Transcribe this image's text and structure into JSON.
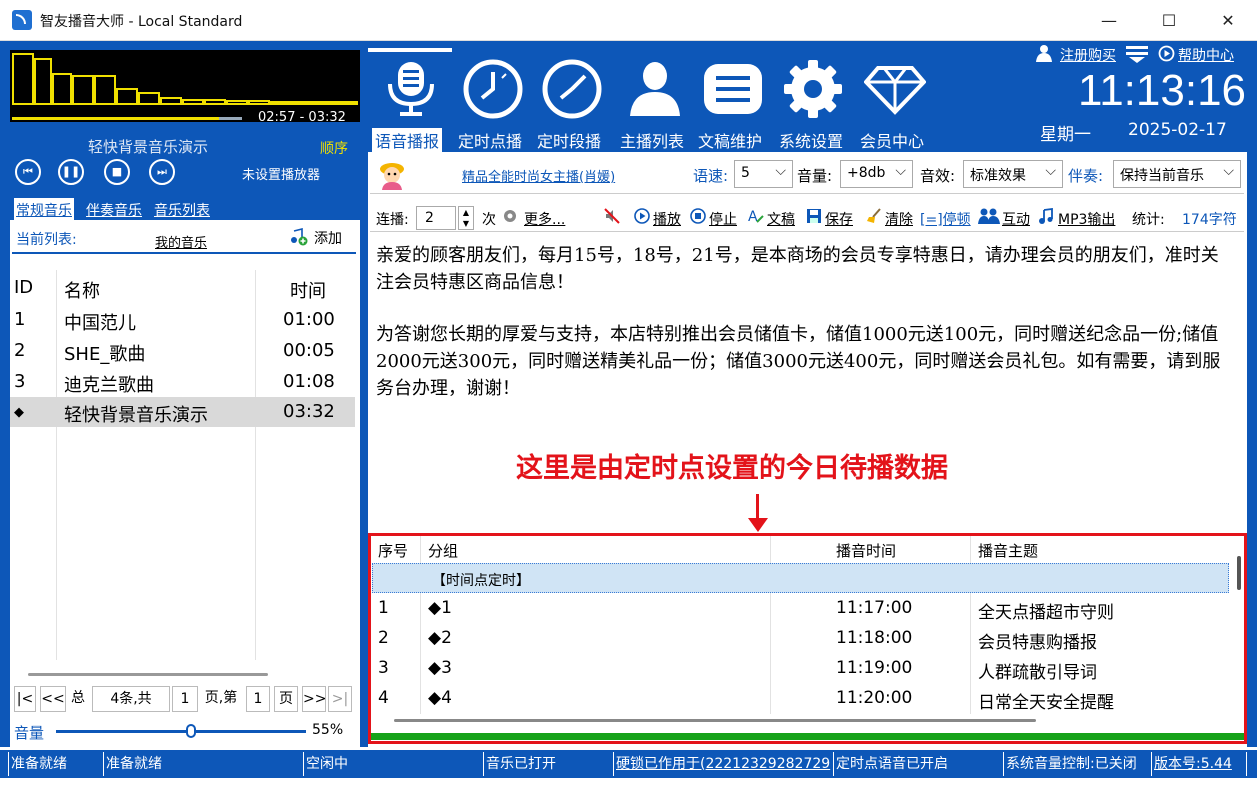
{
  "window": {
    "title": "智友播音大师 - Local Standard",
    "minimize": "—",
    "maximize": "☐",
    "close": "✕"
  },
  "player": {
    "time_range": "02:57 - 03:32",
    "progress": 0.9,
    "now_playing": "轻快背景音乐演示",
    "play_order": "顺序",
    "no_player": "未设置播放器",
    "controls": [
      "prev",
      "pause",
      "stop",
      "next"
    ]
  },
  "left_tabs": [
    "常规音乐",
    "伴奏音乐",
    "音乐列表"
  ],
  "current_list": {
    "label": "当前列表:",
    "name": "我的音乐",
    "add_label": "添加"
  },
  "music_table": {
    "headers": {
      "id": "ID",
      "name": "名称",
      "time": "时间"
    },
    "rows": [
      {
        "id": "1",
        "name": "中国范儿",
        "time": "01:00"
      },
      {
        "id": "2",
        "name": "SHE_歌曲",
        "time": "00:05"
      },
      {
        "id": "3",
        "name": "迪克兰歌曲",
        "time": "01:08"
      },
      {
        "id": "◆",
        "name": "轻快背景音乐演示",
        "time": "03:32"
      }
    ]
  },
  "pager": {
    "first": "|<",
    "prev": "<<",
    "total_label": "总",
    "count": "4条,共",
    "pages": "1",
    "page_label": "页,第",
    "current": "1",
    "page_suffix": "页",
    "next": ">>",
    "last": ">|"
  },
  "volume": {
    "label": "音量",
    "value": "55%",
    "level": 0.55
  },
  "toolbar": {
    "tabs": [
      "语音播报",
      "定时点播",
      "定时段播",
      "主播列表",
      "文稿维护",
      "系统设置",
      "会员中心"
    ],
    "active": 0
  },
  "topright": {
    "register": "注册购买",
    "help": "帮助中心",
    "clock": "11:13:16",
    "weekday": "星期一",
    "date": "2025-02-17"
  },
  "voice": {
    "anchor": "精品全能时尚女主播(肖媛)",
    "speed_label": "语速:",
    "speed": "5",
    "volume_label": "音量:",
    "volume": "+8db",
    "effect_label": "音效:",
    "effect": "标准效果",
    "accomp_label": "伴奏:",
    "accomp": "保持当前音乐"
  },
  "commands": {
    "repeat_label": "连播:",
    "repeat": "2",
    "times": "次",
    "more": "更多...",
    "play": "播放",
    "stop": "停止",
    "doc": "文稿",
    "save": "保存",
    "clear": "清除",
    "pause": "[=]停顿",
    "interact": "互动",
    "mp3": "MP3输出",
    "stats_label": "统计:",
    "stats": "174字符"
  },
  "text": {
    "para1": "亲爱的顾客朋友们，每月15号，18号，21号，是本商场的会员专享特惠日，请办理会员的朋友们，准时关注会员特惠区商品信息！",
    "para2": "为答谢您长期的厚爱与支持，本店特别推出会员储值卡，储值1000元送100元，同时赠送纪念品一份;储值2000元送300元，同时赠送精美礼品一份；储值3000元送400元，同时赠送会员礼包。如有需要，请到服务台办理，谢谢！"
  },
  "annotation": "这里是由定时点设置的今日待播数据",
  "schedule": {
    "headers": {
      "no": "序号",
      "group": "分组",
      "time": "播音时间",
      "topic": "播音主题"
    },
    "group_label": "【时间点定时】",
    "rows": [
      {
        "no": "1",
        "group": "◆1",
        "time": "11:17:00",
        "topic": "全天点播超市守则"
      },
      {
        "no": "2",
        "group": "◆2",
        "time": "11:18:00",
        "topic": "会员特惠购播报"
      },
      {
        "no": "3",
        "group": "◆3",
        "time": "11:19:00",
        "topic": "人群疏散引导词"
      },
      {
        "no": "4",
        "group": "◆4",
        "time": "11:20:00",
        "topic": "日常全天安全提醒"
      }
    ]
  },
  "status": [
    "准备就绪",
    "准备就绪",
    "空闲中",
    "音乐已打开",
    "硬锁已作用于(22212329282729",
    "定时点语音已开启",
    "系统音量控制:已关闭",
    "版本号:5.44"
  ],
  "colors": {
    "brand_blue": "#0d57b8",
    "accent_yellow": "#f0e000",
    "annotation_red": "#e3131a",
    "green": "#16a21a"
  }
}
